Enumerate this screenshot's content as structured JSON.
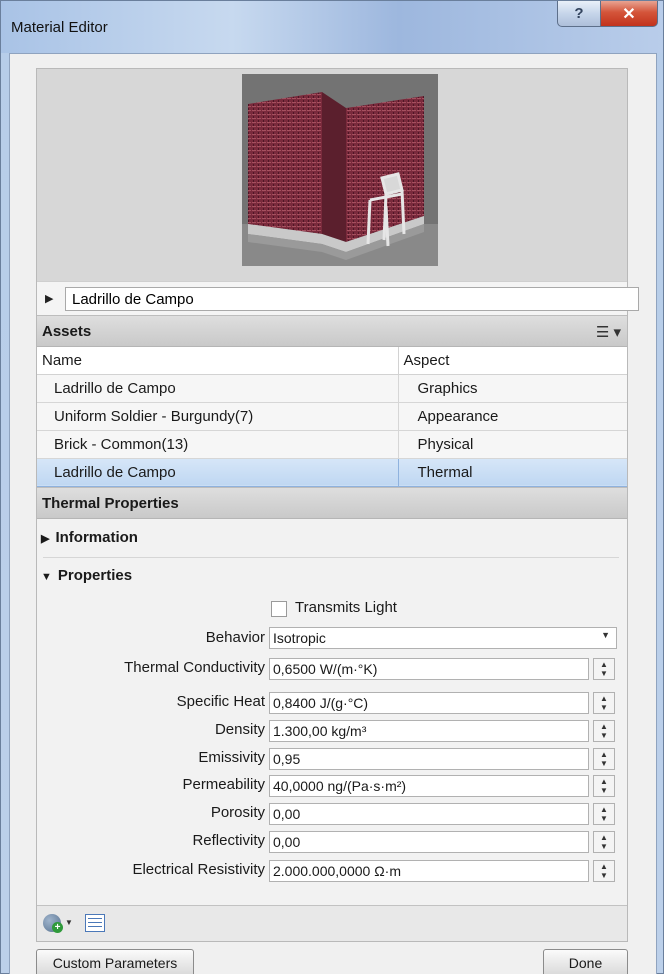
{
  "window": {
    "title": "Material Editor",
    "help_label": "?",
    "close_label": "✕"
  },
  "material": {
    "name": "Ladrillo de Campo"
  },
  "assets": {
    "header": "Assets",
    "columns": [
      "Name",
      "Aspect"
    ],
    "rows": [
      {
        "name": "Ladrillo de Campo",
        "aspect": "Graphics"
      },
      {
        "name": "Uniform Soldier - Burgundy(7)",
        "aspect": "Appearance"
      },
      {
        "name": "Brick - Common(13)",
        "aspect": "Physical"
      },
      {
        "name": "Ladrillo de Campo",
        "aspect": "Thermal"
      }
    ],
    "selected_index": 3,
    "list_icon": "list-view-icon"
  },
  "thermal": {
    "header": "Thermal Properties",
    "information_label": "Information",
    "properties_label": "Properties",
    "transmits_light_label": "Transmits Light",
    "transmits_light_checked": false,
    "behavior": {
      "label": "Behavior",
      "value": "Isotropic"
    },
    "fields": [
      {
        "label": "Thermal Conductivity",
        "value": "0,6500 W/(m·°K)"
      },
      {
        "label": "Specific Heat",
        "value": "0,8400 J/(g·°C)"
      },
      {
        "label": "Density",
        "value": "1.300,00 kg/m³"
      },
      {
        "label": "Emissivity",
        "value": "0,95"
      },
      {
        "label": "Permeability",
        "value": "40,0000 ng/(Pa·s·m²)"
      },
      {
        "label": "Porosity",
        "value": "0,00"
      },
      {
        "label": "Reflectivity",
        "value": "0,00"
      },
      {
        "label": "Electrical Resistivity",
        "value": "2.000.000,0000 Ω·m"
      }
    ]
  },
  "buttons": {
    "custom_parameters": "Custom Parameters",
    "done": "Done"
  },
  "colors": {
    "selection": "#c6dbf4",
    "brick": "#7a2a3c"
  }
}
